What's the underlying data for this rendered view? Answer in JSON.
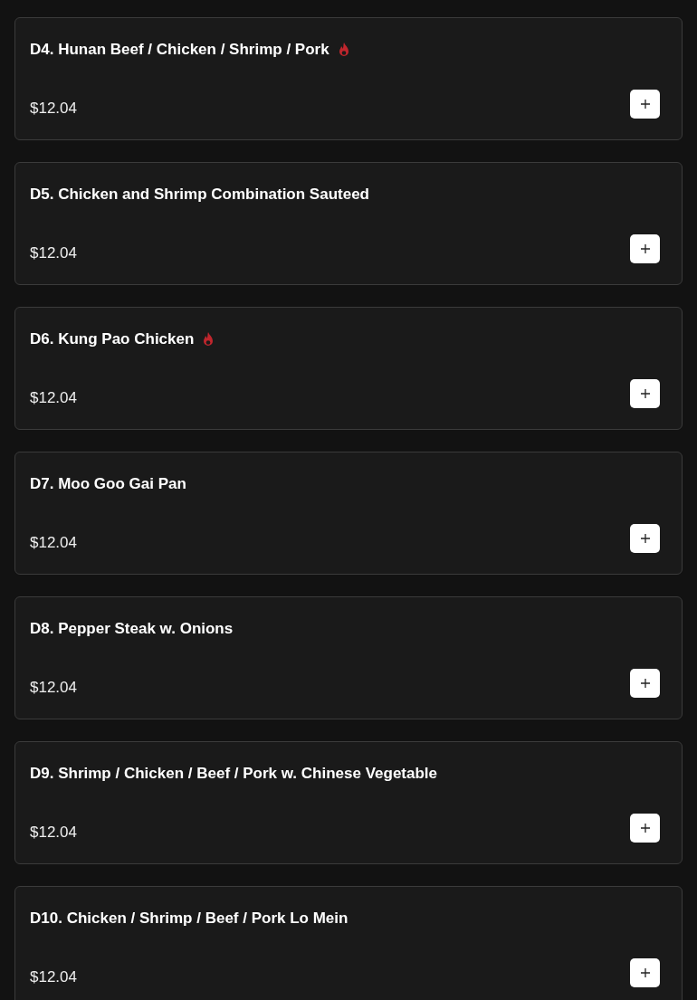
{
  "menu_items": [
    {
      "name": "D4. Hunan Beef / Chicken / Shrimp / Pork",
      "spicy": true,
      "price": "$12.04"
    },
    {
      "name": "D5. Chicken and Shrimp Combination Sauteed",
      "spicy": false,
      "price": "$12.04"
    },
    {
      "name": "D6. Kung Pao Chicken",
      "spicy": true,
      "price": "$12.04"
    },
    {
      "name": "D7. Moo Goo Gai Pan",
      "spicy": false,
      "price": "$12.04"
    },
    {
      "name": "D8. Pepper Steak w. Onions",
      "spicy": false,
      "price": "$12.04"
    },
    {
      "name": "D9. Shrimp / Chicken / Beef / Pork w. Chinese Vegetable",
      "spicy": false,
      "price": "$12.04"
    },
    {
      "name": "D10. Chicken / Shrimp / Beef / Pork Lo Mein",
      "spicy": false,
      "price": "$12.04"
    }
  ]
}
